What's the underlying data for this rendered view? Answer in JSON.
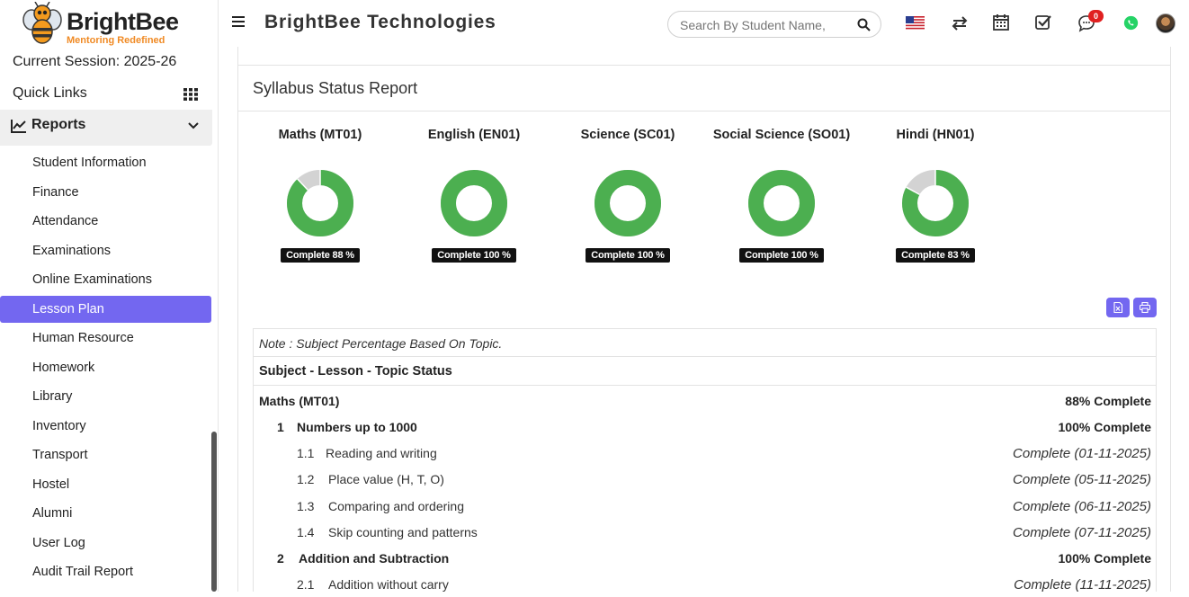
{
  "app": {
    "logo_name": "BrightBee",
    "logo_tagline": "Mentoring Redefined",
    "brand": "BrightBee Technologies"
  },
  "sidebar": {
    "session": "Current Session: 2025-26",
    "quick_links": "Quick Links",
    "section": "Reports",
    "items": [
      {
        "label": "Student Information"
      },
      {
        "label": "Finance"
      },
      {
        "label": "Attendance"
      },
      {
        "label": "Examinations"
      },
      {
        "label": "Online Examinations"
      },
      {
        "label": "Lesson Plan",
        "active": true
      },
      {
        "label": "Human Resource"
      },
      {
        "label": "Homework"
      },
      {
        "label": "Library"
      },
      {
        "label": "Inventory"
      },
      {
        "label": "Transport"
      },
      {
        "label": "Hostel"
      },
      {
        "label": "Alumni"
      },
      {
        "label": "User Log"
      },
      {
        "label": "Audit Trail Report"
      }
    ]
  },
  "header": {
    "search_placeholder": "Search By Student Name,",
    "notification_count": "0",
    "icons": [
      "flag-us-icon",
      "swap-icon",
      "calendar-icon",
      "checkbox-icon",
      "chat-icon",
      "whatsapp-icon"
    ]
  },
  "report": {
    "title": "Syllabus Status Report",
    "subjects": [
      {
        "name": "Maths (MT01)",
        "percent": 88,
        "label": "Complete 88 %"
      },
      {
        "name": "English (EN01)",
        "percent": 100,
        "label": "Complete 100 %"
      },
      {
        "name": "Science (SC01)",
        "percent": 100,
        "label": "Complete 100 %"
      },
      {
        "name": "Social Science (SO01)",
        "percent": 100,
        "label": "Complete 100 %"
      },
      {
        "name": "Hindi (HN01)",
        "percent": 83,
        "label": "Complete 83 %"
      }
    ],
    "colors": {
      "complete": "#4caf50",
      "remaining": "#d3d3d3",
      "accent": "#7367f0"
    },
    "note": "Note : Subject Percentage Based On Topic.",
    "table_title": "Subject - Lesson - Topic Status",
    "rows": [
      {
        "num": "",
        "name": "Maths (MT01)",
        "status": "88% Complete",
        "level": 0
      },
      {
        "num": "1",
        "name": "Numbers up to 1000",
        "status": "100% Complete",
        "level": 1
      },
      {
        "num": "1.1",
        "name": "Reading and writing",
        "status": "Complete (01-11-2025)",
        "level": 2
      },
      {
        "num": "1.2",
        "name": "Place value (H, T, O)",
        "status": "Complete (05-11-2025)",
        "level": 2
      },
      {
        "num": "1.3",
        "name": "Comparing and ordering",
        "status": "Complete (06-11-2025)",
        "level": 2
      },
      {
        "num": "1.4",
        "name": "Skip counting and patterns",
        "status": "Complete (07-11-2025)",
        "level": 2
      },
      {
        "num": "2",
        "name": "Addition and Subtraction",
        "status": "100% Complete",
        "level": 1
      },
      {
        "num": "2.1",
        "name": "Addition without carry",
        "status": "Complete (11-11-2025)",
        "level": 2
      }
    ]
  }
}
